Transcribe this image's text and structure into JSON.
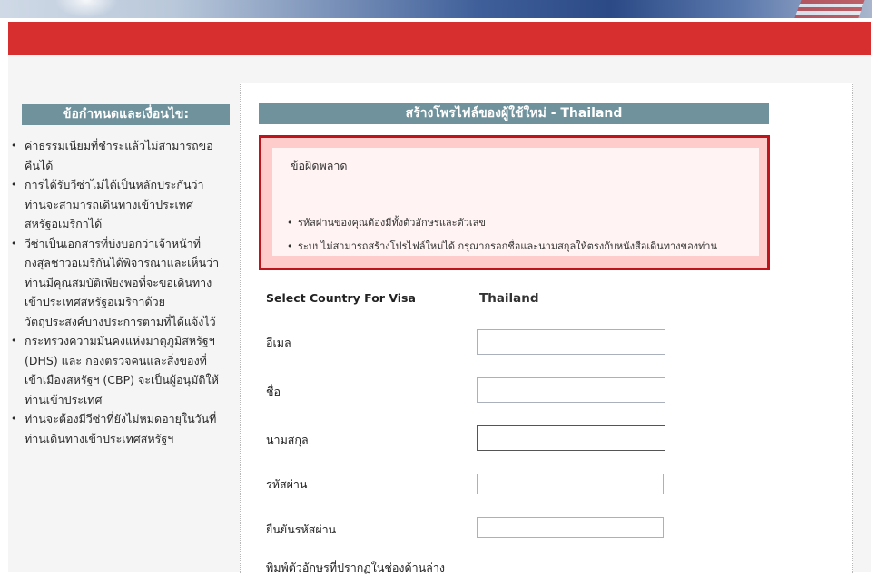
{
  "sidebar": {
    "title": "ข้อกำหนดและเงื่อนไข:",
    "items": [
      "ค่าธรรมเนียมที่ชำระแล้วไม่สามารถขอคืนได้",
      "การได้รับวีซ่าไม่ได้เป็นหลักประกันว่าท่านจะสามารถเดินทางเข้าประเทศสหรัฐอเมริกาได้",
      "วีซ่าเป็นเอกสารที่บ่งบอกว่าเจ้าหน้าที่กงสุลชาวอเมริกันได้พิจารณาและเห็นว่าท่านมีคุณสมบัติเพียงพอที่จะขอเดินทางเข้าประเทศสหรัฐอเมริกาด้วยวัตถุประสงค์บางประการตามที่ได้แจ้งไว้",
      "กระทรวงความมั่นคงแห่งมาตุภูมิสหรัฐฯ (DHS) และ กองตรวจคนและสิ่งของที่เข้าเมืองสหรัฐฯ (CBP) จะเป็นผู้อนุมัติให้ท่านเข้าประเทศ",
      "ท่านจะต้องมีวีซ่าที่ยังไม่หมดอายุในวันที่ท่านเดินทางเข้าประเทศสหรัฐฯ"
    ]
  },
  "main": {
    "title": "สร้างโพรไฟล์ของผู้ใช้ใหม่ - Thailand",
    "error": {
      "title": "ข้อผิดพลาด",
      "messages": [
        "รหัสผ่านของคุณต้องมีทั้งตัวอักษรและตัวเลข",
        "ระบบไม่สามารถสร้างโปรไฟล์ใหม่ได้ กรุณากรอกชื่อและนามสกุลให้ตรงกับหนังสือเดินทางของท่าน"
      ]
    },
    "country_label": "Select Country For Visa",
    "country_value": "Thailand",
    "fields": {
      "email_label": "อีเมล",
      "email_value": "",
      "first_name_label": "ชื่อ",
      "first_name_value": "",
      "last_name_label": "นามสกุล",
      "last_name_value": "",
      "password_label": "รหัสผ่าน",
      "password_value": "",
      "confirm_label": "ยืนยันรหัสผ่าน",
      "confirm_value": "",
      "captcha_label": "พิมพ์ตัวอักษรที่ปรากฏในช่องด้านล่าง"
    }
  }
}
